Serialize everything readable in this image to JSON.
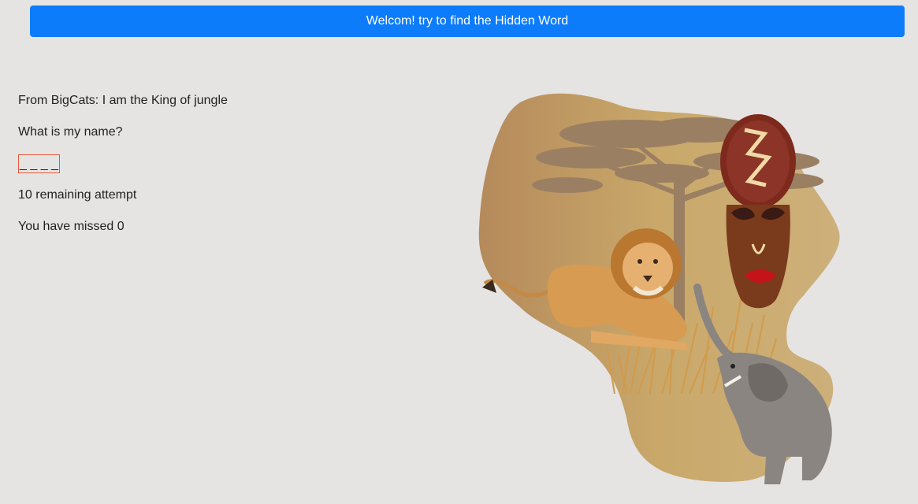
{
  "header": {
    "banner_text": "Welcom! try to find the Hidden Word"
  },
  "game": {
    "hint": "From BigCats: I am the King of jungle",
    "question": "What is my name?",
    "hidden_word_display": "_ _ _ _",
    "remaining": "10 remaining attempt",
    "missed": "You have missed 0"
  },
  "illustration": {
    "subject": "africa-map-with-lion-mask-elephant",
    "colors": {
      "map": "#c9a86a",
      "tree": "#9a7f63",
      "lion": "#d89b52",
      "mask": "#8b2f1f",
      "elephant": "#8a8580"
    }
  },
  "colors": {
    "banner_bg": "#0d7cfb",
    "page_bg": "#e5e4e3",
    "input_border": "#e8593b"
  }
}
